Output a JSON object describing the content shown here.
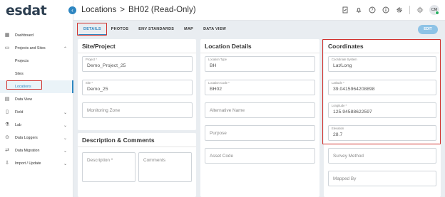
{
  "app": {
    "logo": "esdat"
  },
  "sidebar": {
    "items": [
      {
        "label": "Dashboard",
        "icon": "dashboard-icon",
        "glyph": "▦"
      },
      {
        "label": "Projects and Sites",
        "icon": "folder-icon",
        "glyph": "▭",
        "chevron": "⌃"
      },
      {
        "label": "Projects"
      },
      {
        "label": "Sites"
      },
      {
        "label": "Locations"
      },
      {
        "label": "Data View",
        "icon": "table-icon",
        "glyph": "▤"
      },
      {
        "label": "Field",
        "icon": "field-icon",
        "glyph": "▯",
        "chevron": "⌄"
      },
      {
        "label": "Lab",
        "icon": "flask-icon",
        "glyph": "⚗",
        "chevron": "⌄"
      },
      {
        "label": "Data Loggers",
        "icon": "logger-icon",
        "glyph": "⊙",
        "chevron": "⌄"
      },
      {
        "label": "Data Migration",
        "icon": "migration-icon",
        "glyph": "⇄",
        "chevron": "⌄"
      },
      {
        "label": "Import / Update",
        "icon": "import-icon",
        "glyph": "⇩",
        "chevron": "⌄"
      }
    ]
  },
  "header": {
    "section": "Locations",
    "separator": ">",
    "title": "BH02 (Read-Only)",
    "avatar": "CM"
  },
  "tabs": [
    "DETAILS",
    "PHOTOS",
    "ENV STANDARDS",
    "MAP",
    "DATA VIEW"
  ],
  "edit_label": "EDIT",
  "site_project": {
    "title": "Site/Project",
    "project_label": "Project *",
    "project_value": "Demo_Project_25",
    "site_label": "Site *",
    "site_value": "Demo_25",
    "zone_placeholder": "Monitoring Zone"
  },
  "description": {
    "title": "Description & Comments",
    "description_placeholder": "Description *",
    "comments_placeholder": "Comments"
  },
  "location_details": {
    "title": "Location Details",
    "type_label": "Location Type",
    "type_value": "BH",
    "code_label": "Location Code *",
    "code_value": "BH02",
    "alt_name_placeholder": "Alternative Name",
    "purpose_placeholder": "Purpose",
    "asset_code_placeholder": "Asset Code"
  },
  "coordinates": {
    "title": "Coordinates",
    "system_label": "Coordinate System",
    "system_value": "Lat/Long",
    "lat_label": "Latitude *",
    "lat_value": "39.0415964208898",
    "lon_label": "Longitude *",
    "lon_value": "125.94588622597",
    "elev_label": "Elevation",
    "elev_value": "28.7",
    "survey_placeholder": "Survey Method",
    "mapped_placeholder": "Mapped By"
  },
  "colors": {
    "accent": "#2e86c1",
    "highlight": "#d0312d"
  }
}
